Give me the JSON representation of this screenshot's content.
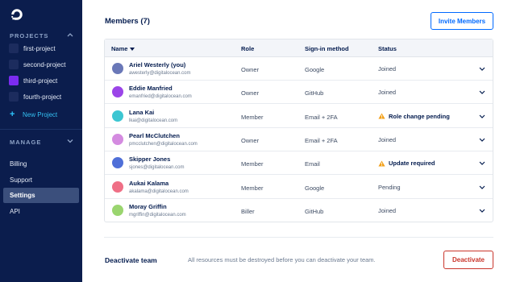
{
  "sidebar": {
    "projects_label": "PROJECTS",
    "projects": [
      {
        "name": "first-project",
        "color": "#1c2c5e"
      },
      {
        "name": "second-project",
        "color": "#1c2c5e"
      },
      {
        "name": "third-project",
        "color": "#7b2cf0"
      },
      {
        "name": "fourth-project",
        "color": "#1c2c5e"
      }
    ],
    "new_project_label": "New Project",
    "manage_label": "MANAGE",
    "links": [
      {
        "label": "Billing",
        "active": false
      },
      {
        "label": "Support",
        "active": false
      },
      {
        "label": "Settings",
        "active": true
      },
      {
        "label": "API",
        "active": false
      }
    ]
  },
  "members": {
    "title": "Members (7)",
    "invite_label": "Invite Members",
    "columns": {
      "name": "Name",
      "role": "Role",
      "signin": "Sign-in method",
      "status": "Status"
    },
    "rows": [
      {
        "name": "Ariel Westerly (you)",
        "email": "awesterly@digitalocean.com",
        "role": "Owner",
        "signin": "Google",
        "status": "Joined",
        "warning": false,
        "avatar_color": "#6a78b8"
      },
      {
        "name": "Eddie Manfried",
        "email": "emanfried@digitalocean.com",
        "role": "Owner",
        "signin": "GitHub",
        "status": "Joined",
        "warning": false,
        "avatar_color": "#9b45e8"
      },
      {
        "name": "Lana Kai",
        "email": "lkai@digitalocean.com",
        "role": "Member",
        "signin": "Email + 2FA",
        "status": "Role change pending",
        "warning": true,
        "avatar_color": "#3cc6d2"
      },
      {
        "name": "Pearl McClutchen",
        "email": "pmcclutchen@digitalocean.com",
        "role": "Owner",
        "signin": "Email + 2FA",
        "status": "Joined",
        "warning": false,
        "avatar_color": "#d48be0"
      },
      {
        "name": "Skipper Jones",
        "email": "sjones@digitalocean.com",
        "role": "Member",
        "signin": "Email",
        "status": "Update required",
        "warning": true,
        "avatar_color": "#4f6fd8"
      },
      {
        "name": "Aukai Kalama",
        "email": "akalama@digitalocean.com",
        "role": "Member",
        "signin": "Google",
        "status": "Pending",
        "warning": false,
        "avatar_color": "#ef6f86"
      },
      {
        "name": "Moray Griffin",
        "email": "mgriffin@digitalocean.com",
        "role": "Biller",
        "signin": "GitHub",
        "status": "Joined",
        "warning": false,
        "avatar_color": "#9ad56f"
      }
    ]
  },
  "deactivate": {
    "title": "Deactivate team",
    "description": "All resources must be destroyed before you can deactivate your team.",
    "button_label": "Deactivate"
  },
  "colors": {
    "sidebar_bg": "#0b1d4d",
    "accent": "#0069ff",
    "danger": "#c9352b",
    "warning": "#f2a019"
  }
}
